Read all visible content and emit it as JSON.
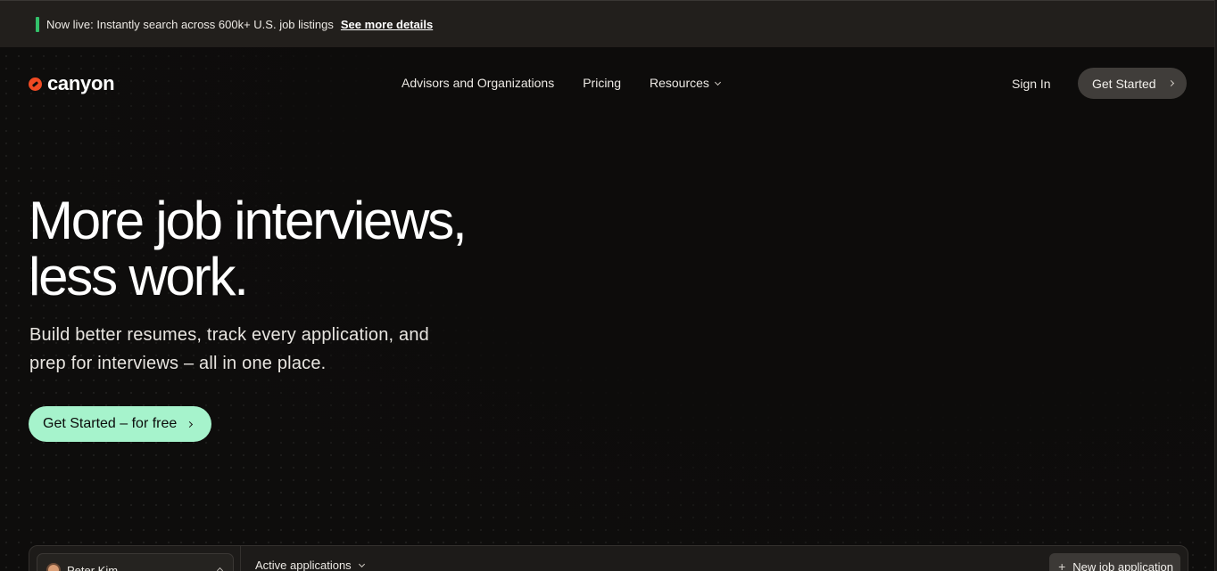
{
  "announcement": {
    "text": "Now live: Instantly search across 600k+ U.S. job listings",
    "link": "See more details",
    "accent_color": "#33c06a"
  },
  "nav": {
    "logo_text": "canyon",
    "logo_icon": "canyon-logo-icon",
    "logo_color": "#f04a23",
    "links": [
      "Advisors and Organizations",
      "Pricing",
      "Resources"
    ],
    "sign_in": "Sign In",
    "cta": "Get Started"
  },
  "hero": {
    "title_line1": "More job interviews,",
    "title_line2": "less work.",
    "subtitle_line1": "Build better resumes, track every application, and",
    "subtitle_line2": "prep for interviews – all in one place.",
    "cta": "Get Started – for free",
    "cta_color": "#a6f3cc"
  },
  "preview": {
    "user_name": "Peter Kim",
    "view_selector": "Active applications",
    "new_button": "New job application",
    "new_icon": "plus-icon"
  }
}
